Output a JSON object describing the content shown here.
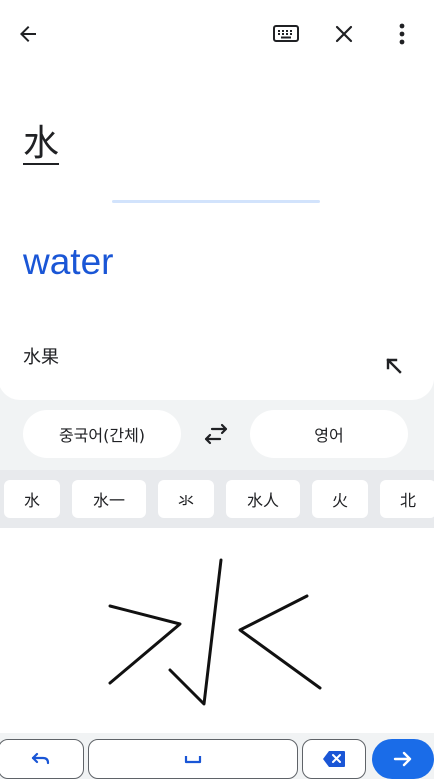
{
  "colors": {
    "accent": "#1a56d6",
    "enter_key": "#1a6ce8",
    "panel_bg": "#f1f3f4",
    "candidate_bg": "#e8eaed"
  },
  "topbar": {
    "icons": [
      "back-arrow-icon",
      "keyboard-icon",
      "close-icon",
      "more-vert-icon"
    ]
  },
  "result": {
    "source_text": "水",
    "translation": "water",
    "suggestion": "水果"
  },
  "languages": {
    "source": "중국어(간체)",
    "target": "영어"
  },
  "candidates": [
    "水",
    "水一",
    "氺",
    "水人",
    "火",
    "北"
  ],
  "keys": {
    "undo_icon": "undo-icon",
    "space_icon": "space-bar-icon",
    "backspace_icon": "backspace-icon",
    "enter_icon": "arrow-forward-icon"
  }
}
